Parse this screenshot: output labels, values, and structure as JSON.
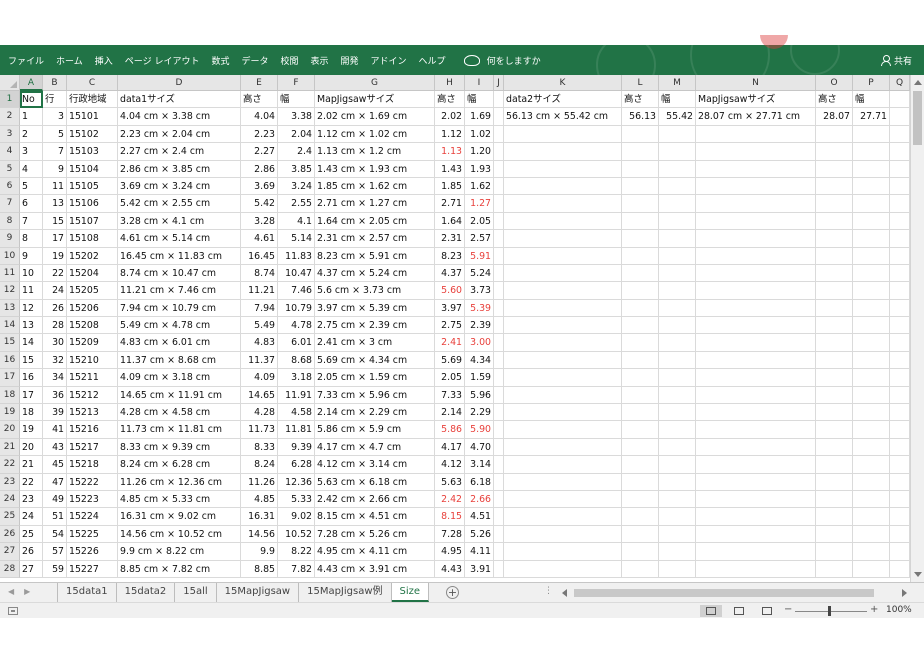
{
  "ribbon": {
    "menu": [
      "ファイル",
      "ホーム",
      "挿入",
      "ページ レイアウト",
      "数式",
      "データ",
      "校閲",
      "表示",
      "開発",
      "アドイン",
      "ヘルプ"
    ],
    "tell_me": "何をしますか",
    "share": "共有",
    "background_color": "#217346"
  },
  "columns": [
    {
      "id": "A",
      "w": 23
    },
    {
      "id": "B",
      "w": 24
    },
    {
      "id": "C",
      "w": 51
    },
    {
      "id": "D",
      "w": 123
    },
    {
      "id": "E",
      "w": 37
    },
    {
      "id": "F",
      "w": 37
    },
    {
      "id": "G",
      "w": 120
    },
    {
      "id": "H",
      "w": 30
    },
    {
      "id": "I",
      "w": 29
    },
    {
      "id": "J",
      "w": 10
    },
    {
      "id": "K",
      "w": 118
    },
    {
      "id": "L",
      "w": 37
    },
    {
      "id": "M",
      "w": 37
    },
    {
      "id": "N",
      "w": 120
    },
    {
      "id": "O",
      "w": 37
    },
    {
      "id": "P",
      "w": 37
    },
    {
      "id": "Q",
      "w": 20
    }
  ],
  "header_row": [
    "No",
    "行",
    "行政地域",
    "data1サイズ",
    "高さ",
    "幅",
    "MapJigsawサイズ",
    "高さ",
    "幅",
    "",
    "data2サイズ",
    "高さ",
    "幅",
    "MapJigsawサイズ",
    "高さ",
    "幅",
    ""
  ],
  "rows": [
    {
      "no": "1",
      "gyo": "3",
      "code": "15101",
      "d1": "4.04 cm × 3.38 cm",
      "h1": "4.04",
      "w1": "3.38",
      "mj": "2.02 cm × 1.69 cm",
      "h2": "2.02",
      "w2": "1.69",
      "k": "56.13 cm × 55.42 cm",
      "l": "56.13",
      "m": "55.42",
      "n": "28.07 cm × 27.71 cm",
      "o": "28.07",
      "p": "27.71"
    },
    {
      "no": "2",
      "gyo": "5",
      "code": "15102",
      "d1": "2.23 cm × 2.04 cm",
      "h1": "2.23",
      "w1": "2.04",
      "mj": "1.12 cm × 1.02 cm",
      "h2": "1.12",
      "w2": "1.02"
    },
    {
      "no": "3",
      "gyo": "7",
      "code": "15103",
      "d1": "2.27 cm × 2.4 cm",
      "h1": "2.27",
      "w1": "2.4",
      "mj": "1.13 cm × 1.2 cm",
      "h2": "1.13",
      "w2": "1.20",
      "h2_red": true
    },
    {
      "no": "4",
      "gyo": "9",
      "code": "15104",
      "d1": "2.86 cm × 3.85 cm",
      "h1": "2.86",
      "w1": "3.85",
      "mj": "1.43 cm × 1.93 cm",
      "h2": "1.43",
      "w2": "1.93"
    },
    {
      "no": "5",
      "gyo": "11",
      "code": "15105",
      "d1": "3.69 cm × 3.24 cm",
      "h1": "3.69",
      "w1": "3.24",
      "mj": "1.85 cm × 1.62 cm",
      "h2": "1.85",
      "w2": "1.62"
    },
    {
      "no": "6",
      "gyo": "13",
      "code": "15106",
      "d1": "5.42 cm × 2.55 cm",
      "h1": "5.42",
      "w1": "2.55",
      "mj": "2.71 cm × 1.27 cm",
      "h2": "2.71",
      "w2": "1.27",
      "w2_red": true
    },
    {
      "no": "7",
      "gyo": "15",
      "code": "15107",
      "d1": "3.28 cm × 4.1 cm",
      "h1": "3.28",
      "w1": "4.1",
      "mj": "1.64 cm × 2.05 cm",
      "h2": "1.64",
      "w2": "2.05"
    },
    {
      "no": "8",
      "gyo": "17",
      "code": "15108",
      "d1": "4.61 cm × 5.14 cm",
      "h1": "4.61",
      "w1": "5.14",
      "mj": "2.31 cm × 2.57 cm",
      "h2": "2.31",
      "w2": "2.57"
    },
    {
      "no": "9",
      "gyo": "19",
      "code": "15202",
      "d1": "16.45 cm × 11.83 cm",
      "h1": "16.45",
      "w1": "11.83",
      "mj": "8.23 cm × 5.91 cm",
      "h2": "8.23",
      "w2": "5.91",
      "w2_red": true
    },
    {
      "no": "10",
      "gyo": "22",
      "code": "15204",
      "d1": "8.74 cm × 10.47 cm",
      "h1": "8.74",
      "w1": "10.47",
      "mj": "4.37 cm × 5.24 cm",
      "h2": "4.37",
      "w2": "5.24"
    },
    {
      "no": "11",
      "gyo": "24",
      "code": "15205",
      "d1": "11.21 cm × 7.46 cm",
      "h1": "11.21",
      "w1": "7.46",
      "mj": "5.6 cm × 3.73 cm",
      "h2": "5.60",
      "w2": "3.73",
      "h2_red": true
    },
    {
      "no": "12",
      "gyo": "26",
      "code": "15206",
      "d1": "7.94 cm × 10.79 cm",
      "h1": "7.94",
      "w1": "10.79",
      "mj": "3.97 cm × 5.39 cm",
      "h2": "3.97",
      "w2": "5.39",
      "w2_red": true
    },
    {
      "no": "13",
      "gyo": "28",
      "code": "15208",
      "d1": "5.49 cm × 4.78 cm",
      "h1": "5.49",
      "w1": "4.78",
      "mj": "2.75 cm × 2.39 cm",
      "h2": "2.75",
      "w2": "2.39"
    },
    {
      "no": "14",
      "gyo": "30",
      "code": "15209",
      "d1": "4.83 cm × 6.01 cm",
      "h1": "4.83",
      "w1": "6.01",
      "mj": "2.41 cm × 3 cm",
      "h2": "2.41",
      "w2": "3.00",
      "h2_red": true,
      "w2_red": true
    },
    {
      "no": "15",
      "gyo": "32",
      "code": "15210",
      "d1": "11.37 cm × 8.68 cm",
      "h1": "11.37",
      "w1": "8.68",
      "mj": "5.69 cm × 4.34 cm",
      "h2": "5.69",
      "w2": "4.34"
    },
    {
      "no": "16",
      "gyo": "34",
      "code": "15211",
      "d1": "4.09 cm × 3.18 cm",
      "h1": "4.09",
      "w1": "3.18",
      "mj": "2.05 cm × 1.59 cm",
      "h2": "2.05",
      "w2": "1.59"
    },
    {
      "no": "17",
      "gyo": "36",
      "code": "15212",
      "d1": "14.65 cm × 11.91 cm",
      "h1": "14.65",
      "w1": "11.91",
      "mj": "7.33 cm × 5.96 cm",
      "h2": "7.33",
      "w2": "5.96"
    },
    {
      "no": "18",
      "gyo": "39",
      "code": "15213",
      "d1": "4.28 cm × 4.58 cm",
      "h1": "4.28",
      "w1": "4.58",
      "mj": "2.14 cm × 2.29 cm",
      "h2": "2.14",
      "w2": "2.29"
    },
    {
      "no": "19",
      "gyo": "41",
      "code": "15216",
      "d1": "11.73 cm × 11.81 cm",
      "h1": "11.73",
      "w1": "11.81",
      "mj": "5.86 cm × 5.9 cm",
      "h2": "5.86",
      "w2": "5.90",
      "h2_red": true,
      "w2_red": true
    },
    {
      "no": "20",
      "gyo": "43",
      "code": "15217",
      "d1": "8.33 cm × 9.39 cm",
      "h1": "8.33",
      "w1": "9.39",
      "mj": "4.17 cm × 4.7 cm",
      "h2": "4.17",
      "w2": "4.70"
    },
    {
      "no": "21",
      "gyo": "45",
      "code": "15218",
      "d1": "8.24 cm × 6.28 cm",
      "h1": "8.24",
      "w1": "6.28",
      "mj": "4.12 cm × 3.14 cm",
      "h2": "4.12",
      "w2": "3.14"
    },
    {
      "no": "22",
      "gyo": "47",
      "code": "15222",
      "d1": "11.26 cm × 12.36 cm",
      "h1": "11.26",
      "w1": "12.36",
      "mj": "5.63 cm × 6.18 cm",
      "h2": "5.63",
      "w2": "6.18"
    },
    {
      "no": "23",
      "gyo": "49",
      "code": "15223",
      "d1": "4.85 cm × 5.33 cm",
      "h1": "4.85",
      "w1": "5.33",
      "mj": "2.42 cm × 2.66 cm",
      "h2": "2.42",
      "w2": "2.66",
      "h2_red": true,
      "w2_red": true
    },
    {
      "no": "24",
      "gyo": "51",
      "code": "15224",
      "d1": "16.31 cm × 9.02 cm",
      "h1": "16.31",
      "w1": "9.02",
      "mj": "8.15 cm × 4.51 cm",
      "h2": "8.15",
      "w2": "4.51",
      "h2_red": true
    },
    {
      "no": "25",
      "gyo": "54",
      "code": "15225",
      "d1": "14.56 cm × 10.52 cm",
      "h1": "14.56",
      "w1": "10.52",
      "mj": "7.28 cm × 5.26 cm",
      "h2": "7.28",
      "w2": "5.26"
    },
    {
      "no": "26",
      "gyo": "57",
      "code": "15226",
      "d1": "9.9 cm × 8.22 cm",
      "h1": "9.9",
      "w1": "8.22",
      "mj": "4.95 cm × 4.11 cm",
      "h2": "4.95",
      "w2": "4.11"
    },
    {
      "no": "27",
      "gyo": "59",
      "code": "15227",
      "d1": "8.85 cm × 7.82 cm",
      "h1": "8.85",
      "w1": "7.82",
      "mj": "4.43 cm × 3.91 cm",
      "h2": "4.43",
      "w2": "3.91"
    }
  ],
  "red_color": "#e8413c",
  "sheet_tabs": [
    "15data1",
    "15data2",
    "15all",
    "15MapJigsaw",
    "15MapJigsaw例",
    "Size"
  ],
  "active_tab": "Size",
  "status": {
    "zoom": "100%",
    "zoom_minus": "−",
    "zoom_plus": "+",
    "add_sheet": "+",
    "hscroll_dots": "⋮"
  }
}
